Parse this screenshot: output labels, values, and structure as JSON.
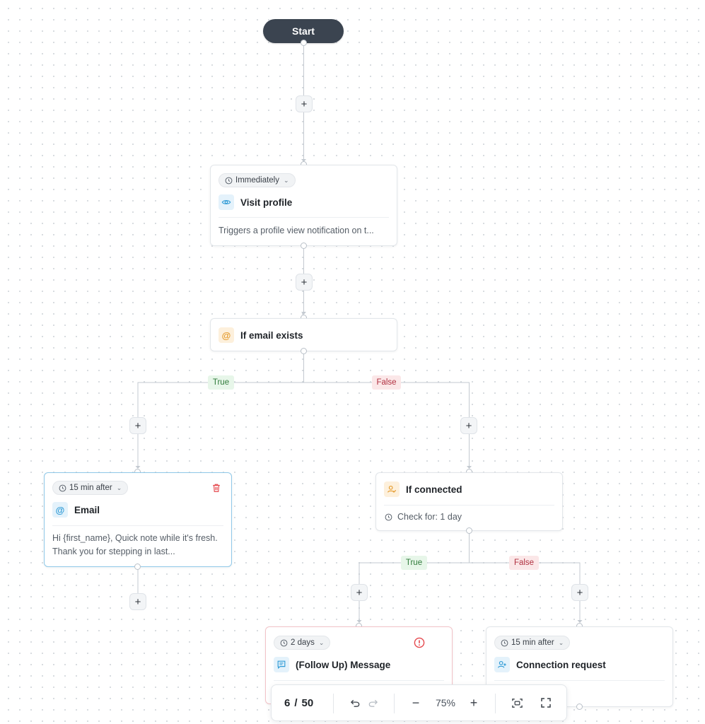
{
  "flow": {
    "start_label": "Start",
    "visit_profile": {
      "timing": "Immediately",
      "title": "Visit profile",
      "description": "Triggers a profile view notification on t..."
    },
    "if_email": {
      "title": "If email exists",
      "true_label": "True",
      "false_label": "False"
    },
    "email": {
      "timing": "15 min after",
      "title": "Email",
      "description": "Hi {first_name}, Quick note while it's fresh. Thank you for stepping in last..."
    },
    "if_connected": {
      "title": "If connected",
      "check": "Check for: 1 day",
      "true_label": "True",
      "false_label": "False"
    },
    "follow_up": {
      "timing": "2 days",
      "title": "(Follow Up) Message"
    },
    "connection_request": {
      "timing": "15 min after",
      "title": "Connection request"
    },
    "add_symbol": "+"
  },
  "toolbar": {
    "page_current": "6",
    "page_separator": "/",
    "page_total": "50",
    "zoom_out": "−",
    "zoom_level": "75%",
    "zoom_in": "+"
  },
  "colors": {
    "start_bg": "#3b4450",
    "accent_blue": "#2f9bd6",
    "accent_orange": "#e59b2d",
    "error_red": "#e5484d",
    "true_green": "#2f7a3a",
    "false_red": "#b03040"
  }
}
